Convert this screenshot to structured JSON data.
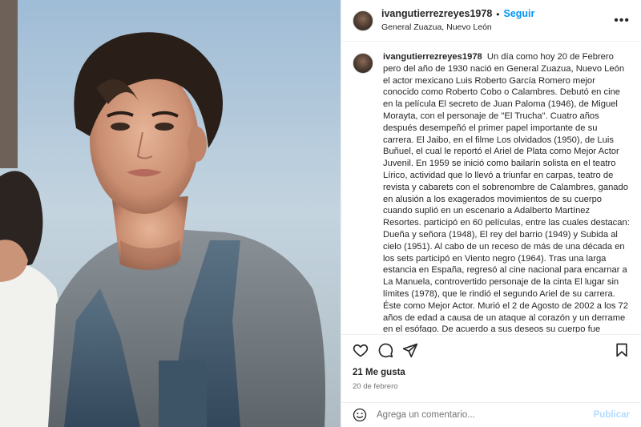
{
  "post": {
    "username": "ivangutierrezreyes1978",
    "separator": "•",
    "follow_label": "Seguir",
    "location": "General Zuazua, Nuevo León",
    "more_label": "•••",
    "caption_username": "ivangutierrezreyes1978",
    "caption_text": "Un día como hoy 20 de Febrero pero del año de 1930 nació en General Zuazua, Nuevo León el actor mexicano Luis Roberto García Romero mejor conocido como Roberto Cobo o Calambres. Debutó en cine en la película El secreto de Juan Paloma (1946), de Miguel Morayta, con el personaje de \"El Trucha\". Cuatro años después desempeñó el primer papel importante de su carrera. El Jaibo, en el filme Los olvidados (1950), de Luis Buñuel, el cual le reportó el Ariel de Plata como Mejor Actor Juvenil. En 1959 se inició como bailarín solista en el teatro Lírico, actividad que lo llevó a triunfar en carpas, teatro de revista y cabarets con el sobrenombre de Calambres, ganado en alusión a los exagerados movimientos de su cuerpo cuando suplió en un escenario a Adalberto Martínez Resortes. participó en 60 películas, entre las cuales destacan: Dueña y señora (1948), El rey del barrio (1949) y Subida al cielo (1951). Al cabo de un receso de más de una década en los sets participó en Viento negro (1964). Tras una larga estancia en España, regresó al cine nacional para encarnar a La Manuela, controvertido personaje de la cinta El lugar sin límites (1978), que le rindió el segundo Ariel de su carrera. Éste como Mejor Actor. Murió el 2 de Agosto de 2002 a los 72 años de edad a causa de un ataque al corazón y un derrame en el esófago. De acuerdo a sus deseos su cuerpo fue cremado y sus cenizas fueron esparcidas en el Océano Pacífico en Acapulco de Juárez.",
    "likes": "21 Me gusta",
    "date": "20 de febrero"
  },
  "comment": {
    "placeholder": "Agrega un comentario...",
    "publish_label": "Publicar"
  },
  "icons": {
    "like": "heart-icon",
    "comment": "comment-icon",
    "share": "share-icon",
    "save": "bookmark-icon",
    "emoji": "emoji-icon",
    "more": "more-icon"
  },
  "colors": {
    "accent": "#0095f6",
    "publish_disabled": "#b3dbff",
    "muted": "#737373",
    "text": "#262626",
    "border": "#efefef"
  }
}
